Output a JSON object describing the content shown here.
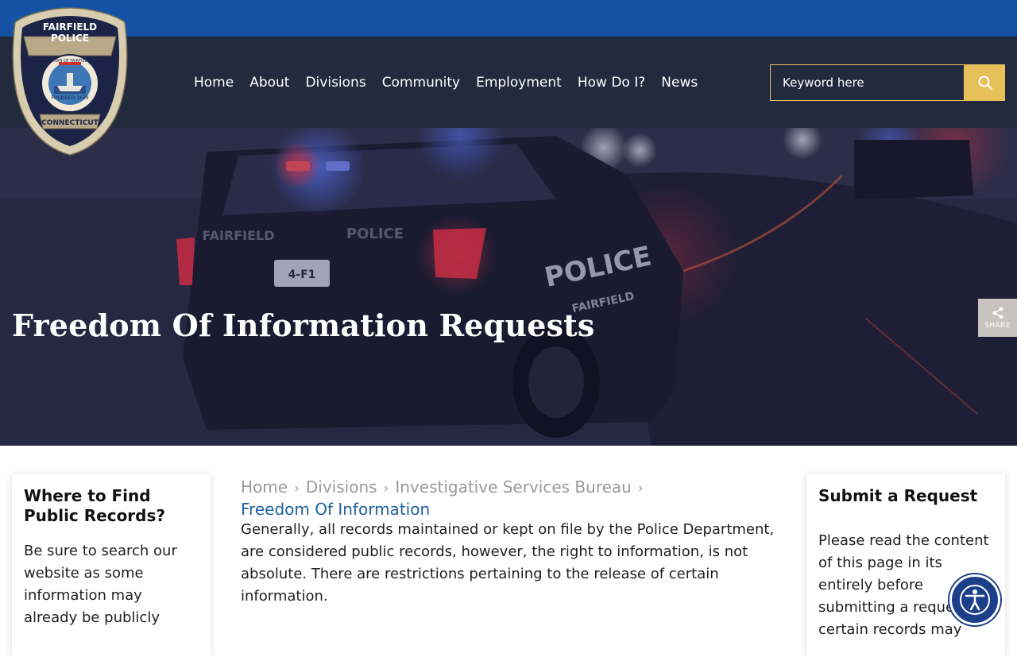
{
  "logo": {
    "line1": "FAIRFIELD",
    "line2": "POLICE",
    "arc": "TOWN OF FAIRFIELD",
    "founded": "FOUNDED 1639",
    "state": "CONNECTICUT"
  },
  "nav": {
    "items": [
      "Home",
      "About",
      "Divisions",
      "Community",
      "Employment",
      "How Do I?",
      "News"
    ]
  },
  "search": {
    "placeholder": "Keyword here",
    "icon": "search-icon"
  },
  "hero": {
    "title": "Freedom Of Information Requests",
    "car_text_left": "FAIRFIELD",
    "car_text_right": "POLICE",
    "car_side_text": "POLICE",
    "car_side_sub": "FAIRFIELD",
    "plate": "4-F1"
  },
  "share": {
    "label": "SHARE",
    "icon": "share-icon"
  },
  "left_card": {
    "title": "Where to Find Public Records?",
    "text": "Be sure to search our website as some information may already be publicly"
  },
  "breadcrumb": {
    "items": [
      "Home",
      "Divisions",
      "Investigative Services Bureau"
    ],
    "separator": "›",
    "current": "Freedom Of Information"
  },
  "content": {
    "paragraph1": "Generally, all records maintained or kept on file by the Police Department, are considered public records, however, the right to information, is not absolute.  There are restrictions pertaining to the release of certain information."
  },
  "right_card": {
    "title": "Submit a Request",
    "text": "Please read the content of this page in its entirely before submitting a request, certain records may"
  },
  "accessibility": {
    "icon": "accessibility-icon"
  },
  "colors": {
    "top_strip": "#1652a3",
    "nav_bg": "#222a3e",
    "accent_gold": "#e8c05a",
    "link_blue": "#1f5f9e"
  }
}
